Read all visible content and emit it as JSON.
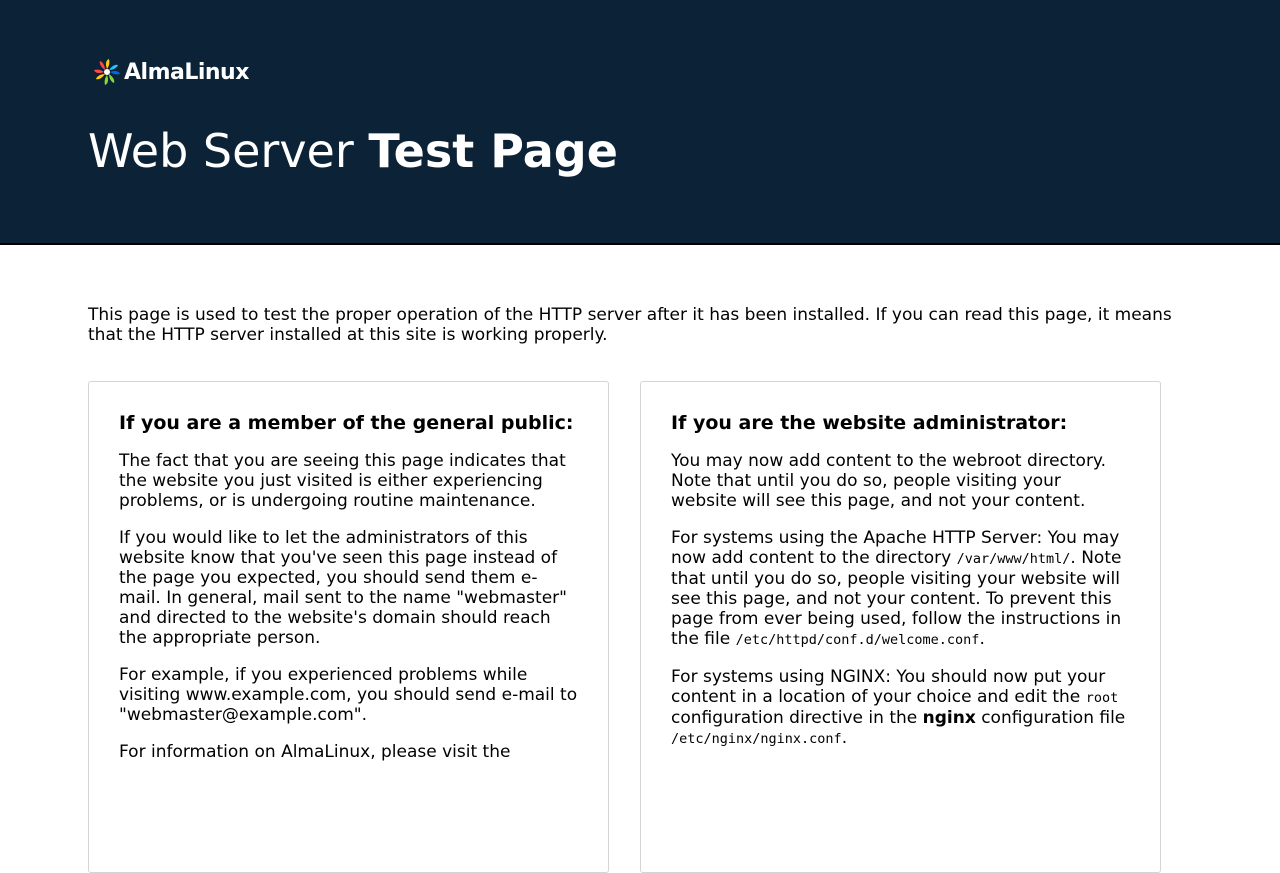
{
  "header": {
    "logo_text": "AlmaLinux",
    "title_light": "Web Server ",
    "title_bold": "Test Page",
    "background_color": "#0b2237"
  },
  "intro": "This page is used to test the proper operation of the HTTP server after it has been installed. If you can read this page, it means that the HTTP server installed at this site is working properly.",
  "public_card": {
    "heading": "If you are a member of the general public:",
    "p1": "The fact that you are seeing this page indicates that the website you just visited is either experiencing problems, or is undergoing routine maintenance.",
    "p2": "If you would like to let the administrators of this website know that you've seen this page instead of the page you expected, you should send them e-mail. In general, mail sent to the name \"webmaster\" and directed to the website's domain should reach the appropriate person.",
    "p3": "For example, if you experienced problems while visiting www.example.com, you should send e-mail to \"webmaster@example.com\".",
    "p4": "For information on AlmaLinux, please visit the"
  },
  "admin_card": {
    "heading": "If you are the website administrator:",
    "p1": "You may now add content to the webroot directory. Note that until you do so, people visiting your website will see this page, and not your content.",
    "p2_a": "For systems using the Apache HTTP Server: You may now add content to the directory ",
    "p2_code1": "/var/www/html/",
    "p2_b": ". Note that until you do so, people visiting your website will see this page, and not your content. To prevent this page from ever being used, follow the instructions in the file ",
    "p2_code2": "/etc/httpd/conf.d/welcome.conf",
    "p2_c": ".",
    "p3_a": "For systems using NGINX: You should now put your content in a location of your choice and edit the ",
    "p3_code1": "root",
    "p3_b": " configuration directive in the ",
    "p3_bold": "nginx",
    "p3_c": " configuration file ",
    "p3_code2": "/etc/nginx/nginx.conf",
    "p3_d": "."
  }
}
